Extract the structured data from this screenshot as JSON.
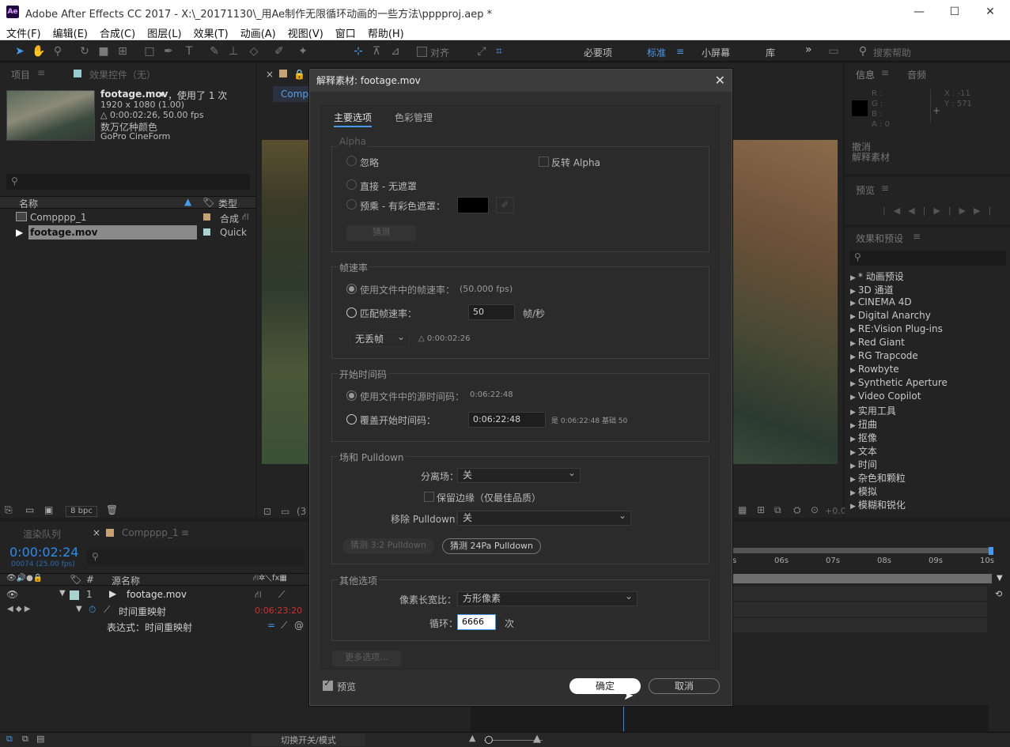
{
  "window": {
    "title": "Adobe After Effects CC 2017 - X:\\_20171130\\_用Ae制作无限循环动画的一些方法\\pppproj.aep *",
    "logo": "Ae",
    "min": "—",
    "max": "☐",
    "close": "✕"
  },
  "menu": [
    "文件(F)",
    "编辑(E)",
    "合成(C)",
    "图层(L)",
    "效果(T)",
    "动画(A)",
    "视图(V)",
    "窗口",
    "帮助(H)"
  ],
  "toolbar": {
    "align_label": "对齐",
    "workspaces": [
      "必要项",
      "标准",
      "小屏幕",
      "库"
    ],
    "active_workspace": "标准",
    "more": "»",
    "search_placeholder": "搜索帮助"
  },
  "project": {
    "tab_project": "项目",
    "tab_effects": "效果控件（无）",
    "clip_name": "footage.mov",
    "clip_usage": "，使用了 1 次",
    "clip_res": "1920 x 1080 (1.00)",
    "clip_dur": "△ 0:00:02:26, 50.00 fps",
    "clip_color": "数万亿种颜色",
    "clip_codec": "GoPro CineForm",
    "search_placeholder": "",
    "col_name": "名称",
    "col_type": "类型",
    "rows": [
      {
        "name": "Compppp_1",
        "type": "合成"
      },
      {
        "name": "footage.mov",
        "type": "Quick"
      }
    ],
    "bpc": "8 bpc"
  },
  "comp_tab": "Compp",
  "viewer": {
    "zoom": "(3",
    "value": "+0.0"
  },
  "timeline": {
    "tab_render": "渲染队列",
    "tab_comp": "Compppp_1",
    "timecode": "0:00:02:24",
    "timecode_sub": "00074 (25.00 fps)",
    "col_num": "#",
    "col_source": "源名称",
    "layer_num": "1",
    "layer_name": "footage.mov",
    "prop_name": "时间重映射",
    "prop_value": "0:06:23:20",
    "expr_label": "表达式：时间重映射",
    "ruler": [
      "06s",
      "07s",
      "08s",
      "09s",
      "10s"
    ],
    "toggle_label": "切换开关/模式"
  },
  "info": {
    "tab_info": "信息",
    "tab_audio": "音频",
    "rgb": [
      "R :",
      "G :",
      "B :",
      "A : 0"
    ],
    "xy": [
      "X : -11",
      "Y : 571"
    ],
    "undo": "撤消",
    "undo_item": "解释素材"
  },
  "preview": {
    "title": "预览"
  },
  "effects": {
    "title": "效果和预设",
    "items": [
      "* 动画预设",
      "3D 通道",
      "CINEMA 4D",
      "Digital Anarchy",
      "RE:Vision Plug-ins",
      "Red Giant",
      "RG Trapcode",
      "Rowbyte",
      "Synthetic Aperture",
      "Video Copilot",
      "实用工具",
      "扭曲",
      "抠像",
      "文本",
      "时间",
      "杂色和颗粒",
      "模拟",
      "模糊和锐化"
    ]
  },
  "dialog": {
    "title": "解释素材: footage.mov",
    "tabs": [
      "主要选项",
      "色彩管理"
    ],
    "alpha": {
      "title": "Alpha",
      "ignore": "忽略",
      "invert": "反转 Alpha",
      "straight": "直接 - 无遮罩",
      "premult": "预乘 - 有彩色遮罩：",
      "guess": "猜测"
    },
    "framerate": {
      "title": "帧速率",
      "use_file": "使用文件中的帧速率：",
      "use_file_value": "(50.000 fps)",
      "conform": "匹配帧速率：",
      "conform_value": "50",
      "unit": "帧/秒",
      "drop": "无丢帧",
      "duration": "△ 0:00:02:26"
    },
    "timecode": {
      "title": "开始时间码",
      "use_file": "使用文件中的源时间码：",
      "use_file_value": "0:06:22:48",
      "override": "覆盖开始时间码：",
      "override_value": "0:06:22:48",
      "hint": "是 0:06:22:48",
      "base": "基础 50"
    },
    "fields": {
      "title": "场和 Pulldown",
      "separate_label": "分离场：",
      "separate_value": "关",
      "preserve": "保留边缘（仅最佳品质）",
      "remove_label": "移除 Pulldown：",
      "remove_value": "关",
      "guess32": "猜测 3:2 Pulldown",
      "guess24": "猜测 24Pa Pulldown"
    },
    "other": {
      "title": "其他选项",
      "par_label": "像素长宽比：",
      "par_value": "方形像素",
      "loop_label": "循环：",
      "loop_value": "6666",
      "loop_unit": "次"
    },
    "more": "更多选项...",
    "preview": "预览",
    "ok": "确定",
    "cancel": "取消"
  },
  "colors": {
    "accent": "#2d8ceb",
    "timecode": "#2d8ceb",
    "red_value": "#d03030",
    "button_primary": "#ffffff"
  }
}
